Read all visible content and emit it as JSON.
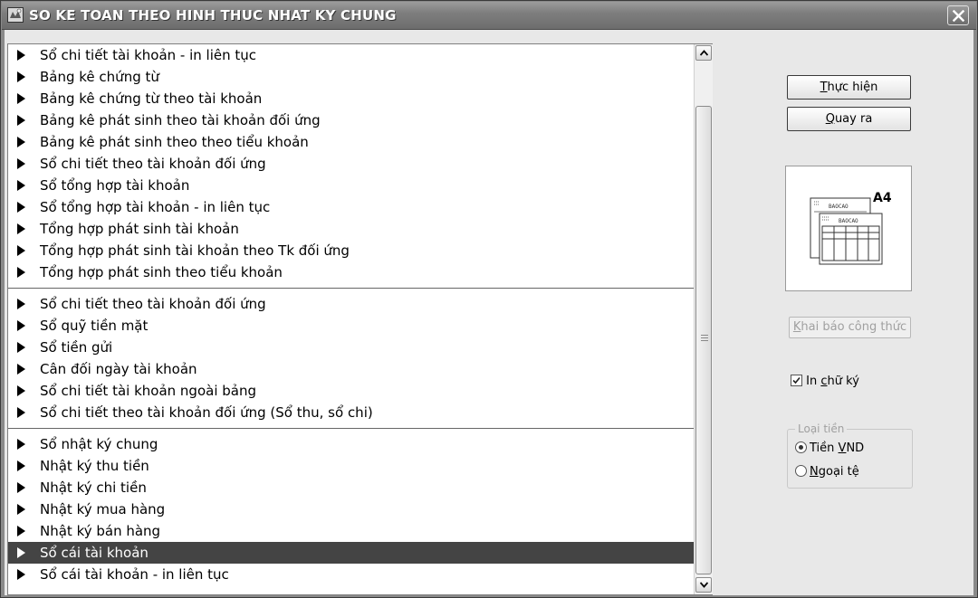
{
  "window": {
    "title": "SO KE TOAN THEO HINH THUC NHAT KY CHUNG",
    "icon": "app-icon",
    "close_icon": "close-icon"
  },
  "report_list": {
    "groups": [
      [
        "Sổ chi tiết tài khoản - in liên tục",
        "Bảng kê chứng từ",
        "Bảng kê chứng từ theo tài khoản",
        "Bảng kê phát sinh theo tài khoản đối ứng",
        "Bảng kê phát sinh theo theo tiểu khoản",
        "Sổ chi tiết theo tài khoản đối ứng",
        "Sổ tổng hợp tài khoản",
        "Sổ tổng hợp tài khoản - in liên tục",
        "Tổng hợp phát sinh tài khoản",
        "Tổng hợp phát sinh tài khoản theo Tk đối ứng",
        "Tổng hợp phát sinh theo tiểu khoản"
      ],
      [
        "Sổ chi tiết theo tài khoản đối ứng",
        "Sổ quỹ tiền mặt",
        "Sổ tiền gửi",
        "Cân đối ngày tài khoản",
        "Sổ chi tiết tài khoản ngoài bảng",
        "Sổ chi tiết theo tài khoản đối ứng (Sổ thu, sổ chi)"
      ],
      [
        "Sổ nhật ký chung",
        "Nhật ký thu tiền",
        "Nhật ký chi tiền",
        "Nhật ký mua hàng",
        "Nhật ký bán hàng",
        "Sổ cái tài khoản",
        "Sổ cái tài khoản - in liên tục"
      ]
    ],
    "selected": "Sổ cái tài khoản"
  },
  "buttons": {
    "execute": {
      "hotkey": "T",
      "rest": "hực hiện"
    },
    "back": {
      "hotkey": "Q",
      "rest": "uay ra"
    },
    "formula": {
      "hotkey": "K",
      "rest": "hai báo công thức"
    }
  },
  "preview": {
    "paper_label": "A4",
    "sheet_label": "BAOCAO",
    "icon": "report-preview-icon"
  },
  "sign_option": {
    "checked": true,
    "prefix": "In ",
    "hotkey": "c",
    "rest": "hữ ký"
  },
  "currency": {
    "legend": "Loại tiền",
    "options": [
      {
        "prefix": "Tiền ",
        "hotkey": "V",
        "rest": "ND",
        "selected": true
      },
      {
        "prefix": "",
        "hotkey": "N",
        "rest": "goại tệ",
        "selected": false
      }
    ]
  }
}
